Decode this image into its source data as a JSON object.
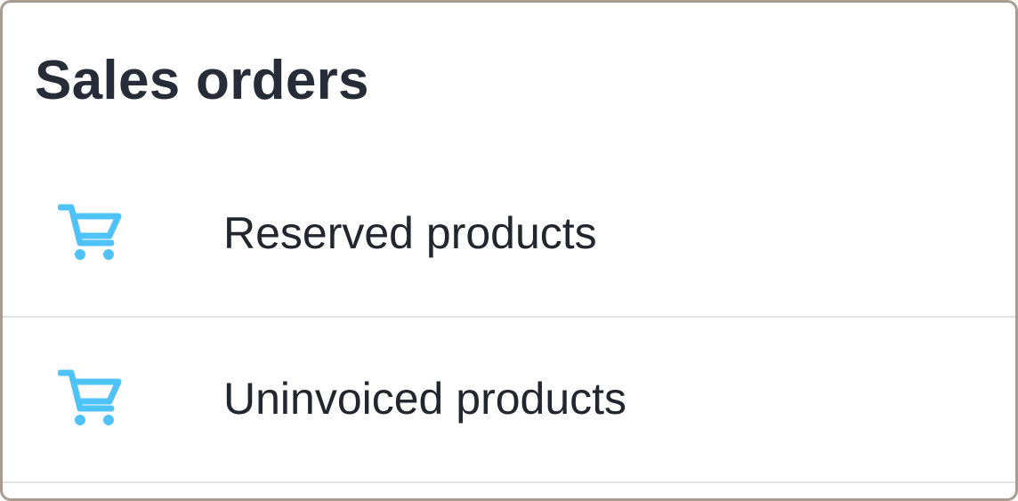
{
  "page": {
    "title": "Sales orders"
  },
  "menu": {
    "items": [
      {
        "label": "Reserved products",
        "icon": "shopping-cart-icon"
      },
      {
        "label": "Uninvoiced products",
        "icon": "shopping-cart-icon"
      }
    ]
  },
  "colors": {
    "icon_accent": "#4fc3f7",
    "title_text": "#262c38",
    "item_text": "#22262e",
    "divider": "#e2e2e2",
    "card_border": "#a89b91"
  }
}
